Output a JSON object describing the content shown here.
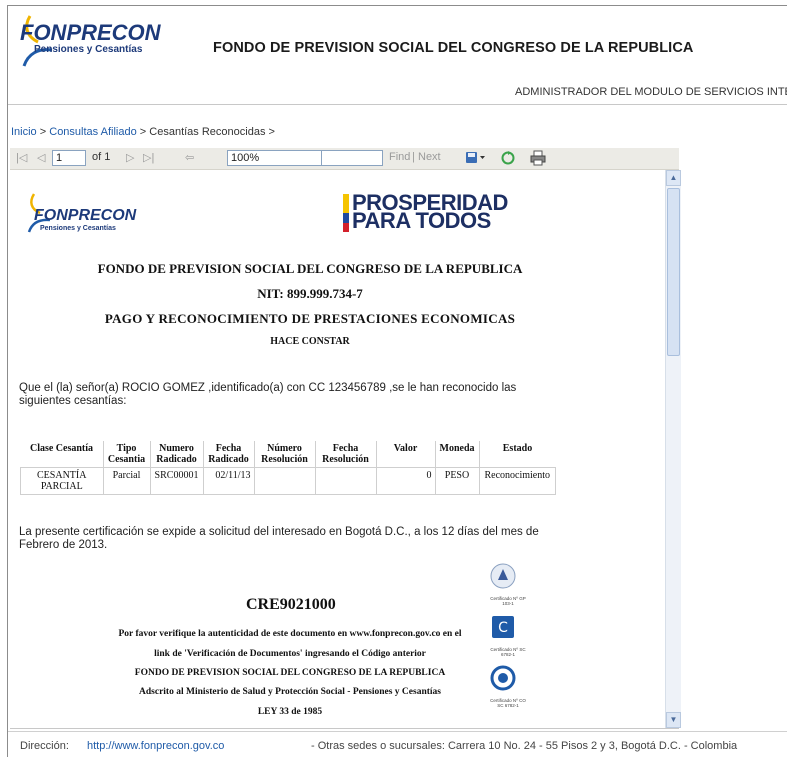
{
  "header": {
    "logo_name": "FONPRECON",
    "logo_tagline": "Pensiones y Cesantías",
    "title": "FONDO DE PREVISION SOCIAL DEL CONGRESO DE LA REPUBLICA",
    "role": "ADMINISTRADOR DEL MODULO DE SERVICIOS INTERNE"
  },
  "breadcrumb": {
    "items": [
      "Inicio",
      "Consultas Afiliado",
      "Cesantías Reconocidas"
    ],
    "separator": ">"
  },
  "toolbar": {
    "page_value": "1",
    "page_of": "of 1",
    "zoom": "100%",
    "find_value": "",
    "find_label": "Find",
    "next_label": "Next",
    "icons": [
      "first-page-icon",
      "previous-page-icon",
      "next-page-icon",
      "last-page-icon",
      "back-icon",
      "export-icon",
      "refresh-icon",
      "print-icon"
    ]
  },
  "report": {
    "logo_name": "FONPRECON",
    "logo_tagline": "Pensiones y Cesantías",
    "slogan_line1": "PROSPERIDAD",
    "slogan_line2": "PARA TODOS",
    "entity": "FONDO DE PREVISION SOCIAL DEL CONGRESO DE LA REPUBLICA",
    "nit": "NIT: 899.999.734-7",
    "section": "PAGO Y RECONOCIMIENTO DE PRESTACIONES ECONOMICAS",
    "hace_constar": "HACE CONSTAR",
    "statement": "Que el (la) señor(a) ROCIO GOMEZ ,identificado(a) con CC 123456789 ,se le han reconocido las siguientes cesantías:",
    "table": {
      "columns": [
        "Clase Cesantía",
        "Tipo Cesantia",
        "Numero Radicado",
        "Fecha Radicado",
        "Número Resolución",
        "Fecha Resolución",
        "Valor",
        "Moneda",
        "Estado"
      ],
      "rows": [
        [
          "CESANTÍA PARCIAL",
          "Parcial",
          "SRC00001",
          "02/11/13",
          "",
          "",
          "0",
          "PESO",
          "Reconocimiento"
        ]
      ]
    },
    "closing": "La presente certificación se expide a solicitud del interesado en Bogotá D.C., a los 12 días del mes de Febrero de 2013.",
    "code": "CRE9021000",
    "footer_lines": [
      "Por favor verifique la autenticidad de este documento en www.fonprecon.gov.co en el",
      "link de 'Verificación de Documentos' ingresando el Código anterior",
      "FONDO DE PREVISION SOCIAL DEL CONGRESO DE LA REPUBLICA",
      "Adscrito al Ministerio de Salud y Protección Social - Pensiones y Cesantías",
      "LEY 33 de 1985"
    ],
    "certifications": [
      "Certificado Nº GP 103-1",
      "Certificado Nº SC 6782-1",
      "Certificado Nº CO SC 6782-1"
    ]
  },
  "statusbar": {
    "label": "Dirección:",
    "url": "http://www.fonprecon.gov.co",
    "other": "- Otras sedes o sucursales: Carrera 10 No. 24 - 55 Pisos 2 y 3, Bogotá D.C. - Colombia"
  },
  "colors": {
    "brand_blue": "#1d3a7a",
    "link": "#1f5ba8",
    "toolbar_bg": "#ecebe6",
    "flag_yellow": "#f5c400",
    "flag_blue": "#1f4aa0",
    "flag_red": "#d3202b"
  }
}
